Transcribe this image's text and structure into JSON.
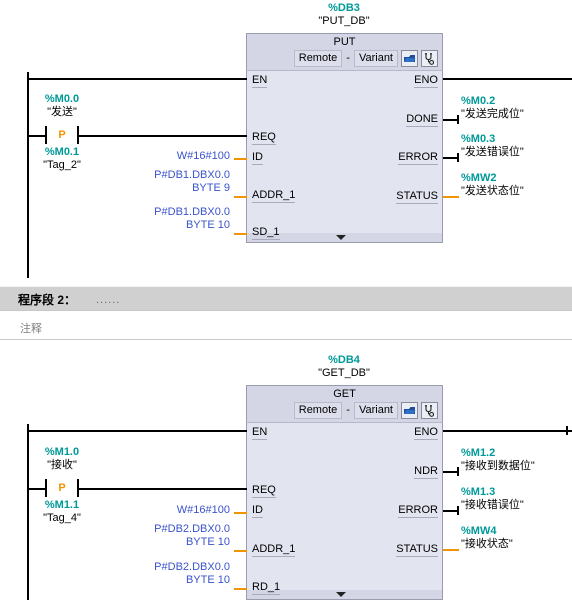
{
  "networks": [
    {
      "id": "network-1",
      "instance": {
        "db": "%DB3",
        "name": "\"PUT_DB\""
      },
      "block": {
        "title": "PUT",
        "mode_left": "Remote",
        "dash": "-",
        "mode_right": "Variant",
        "icon_open": "open-block-icon",
        "icon_probe": "probe-icon",
        "expand_icon": "chevron-down-icon"
      },
      "inputs": [
        {
          "pin": "EN",
          "type": "bool"
        },
        {
          "pin": "REQ",
          "type": "bool"
        },
        {
          "pin": "ID",
          "type": "word"
        },
        {
          "pin": "ADDR_1",
          "type": "word"
        },
        {
          "pin": "SD_1",
          "type": "word"
        }
      ],
      "outputs": [
        {
          "pin": "ENO",
          "type": "bool"
        },
        {
          "pin": "DONE",
          "type": "bool"
        },
        {
          "pin": "ERROR",
          "type": "bool"
        },
        {
          "pin": "STATUS",
          "type": "word"
        }
      ],
      "contact": {
        "type": "positive-edge",
        "glyph": "P",
        "top": {
          "addr": "%M0.0",
          "sym": "\"发送\""
        },
        "bottom": {
          "addr": "%M0.1",
          "sym": "\"Tag_2\""
        }
      },
      "values": [
        {
          "line1": "",
          "line2": "W#16#100",
          "pin": "ID"
        },
        {
          "line1": "P#DB1.DBX0.0",
          "line2": "BYTE 9",
          "pin": "ADDR_1"
        },
        {
          "line1": "P#DB1.DBX0.0",
          "line2": "BYTE 10",
          "pin": "SD_1"
        }
      ],
      "out_operands": [
        {
          "addr": "%M0.2",
          "sym": "\"发送完成位\"",
          "type": "bool",
          "pin": "DONE"
        },
        {
          "addr": "%M0.3",
          "sym": "\"发送错误位\"",
          "type": "bool",
          "pin": "ERROR"
        },
        {
          "addr": "%MW2",
          "sym": "\"发送状态位\"",
          "type": "word",
          "pin": "STATUS"
        }
      ]
    },
    {
      "id": "network-2",
      "header": {
        "title": "程序段 2：",
        "dots": "......",
        "comment": "注释"
      },
      "instance": {
        "db": "%DB4",
        "name": "\"GET_DB\""
      },
      "block": {
        "title": "GET",
        "mode_left": "Remote",
        "dash": "-",
        "mode_right": "Variant",
        "icon_open": "open-block-icon",
        "icon_probe": "probe-icon",
        "expand_icon": "chevron-down-icon"
      },
      "inputs": [
        {
          "pin": "EN",
          "type": "bool"
        },
        {
          "pin": "REQ",
          "type": "bool"
        },
        {
          "pin": "ID",
          "type": "word"
        },
        {
          "pin": "ADDR_1",
          "type": "word"
        },
        {
          "pin": "RD_1",
          "type": "word"
        }
      ],
      "outputs": [
        {
          "pin": "ENO",
          "type": "bool"
        },
        {
          "pin": "NDR",
          "type": "bool"
        },
        {
          "pin": "ERROR",
          "type": "bool"
        },
        {
          "pin": "STATUS",
          "type": "word"
        }
      ],
      "contact": {
        "type": "positive-edge",
        "glyph": "P",
        "top": {
          "addr": "%M1.0",
          "sym": "\"接收\""
        },
        "bottom": {
          "addr": "%M1.1",
          "sym": "\"Tag_4\""
        }
      },
      "values": [
        {
          "line1": "",
          "line2": "W#16#100",
          "pin": "ID"
        },
        {
          "line1": "P#DB2.DBX0.0",
          "line2": "BYTE 10",
          "pin": "ADDR_1"
        },
        {
          "line1": "P#DB2.DBX0.0",
          "line2": "BYTE 10",
          "pin": "RD_1"
        }
      ],
      "out_operands": [
        {
          "addr": "%M1.2",
          "sym": "\"接收到数据位\"",
          "type": "bool",
          "pin": "NDR"
        },
        {
          "addr": "%M1.3",
          "sym": "\"接收错误位\"",
          "type": "bool",
          "pin": "ERROR"
        },
        {
          "addr": "%MW4",
          "sym": "\"接收状态\"",
          "type": "word",
          "pin": "STATUS"
        }
      ]
    }
  ],
  "colors": {
    "address_teal": "#009999",
    "value_blue": "#3a53cc",
    "wire_bool": "#000000",
    "wire_word": "#f29400",
    "block_body": "#e2e4ef",
    "block_head": "#d4d6e6",
    "band_gray": "#d0d0d0"
  }
}
